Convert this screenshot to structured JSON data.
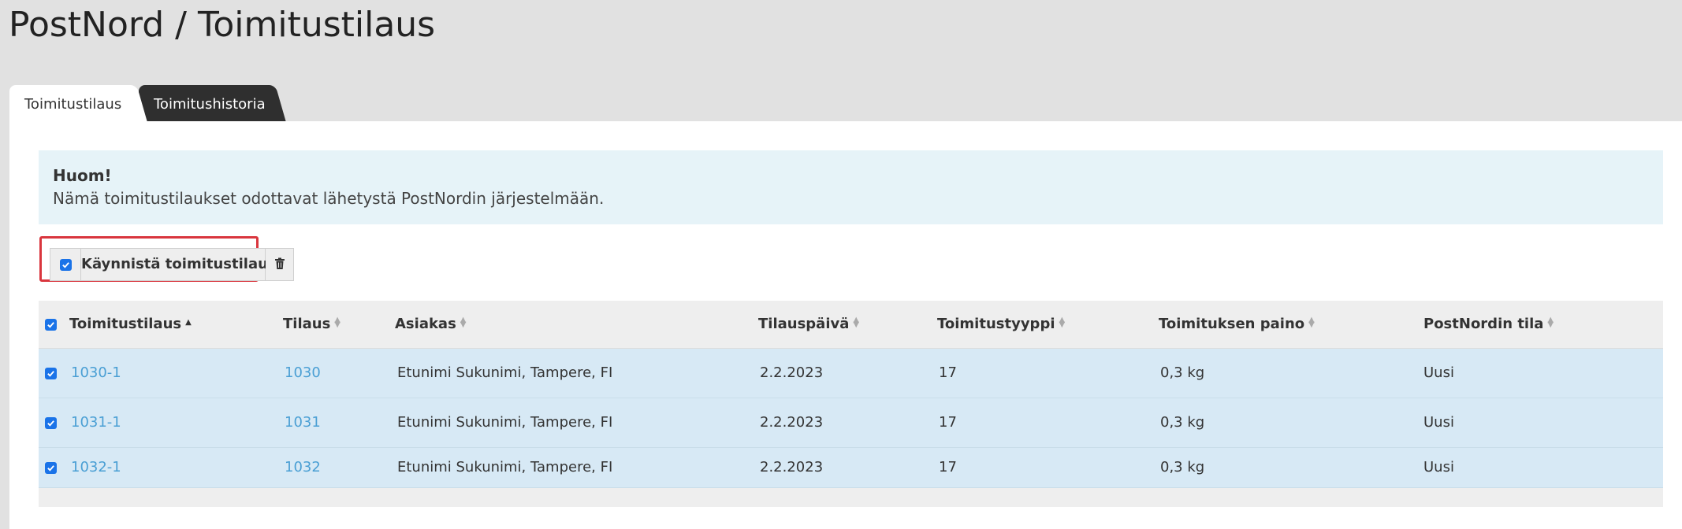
{
  "page": {
    "title": "PostNord / Toimitustilaus"
  },
  "tabs": [
    {
      "label": "Toimitustilaus",
      "active": true
    },
    {
      "label": "Toimitushistoria",
      "active": false
    }
  ],
  "notice": {
    "title": "Huom!",
    "text": "Nämä toimitustilaukset odottavat lähetystä PostNordin järjestelmään."
  },
  "toolbar": {
    "select_all_checked": true,
    "start_label": "Käynnistä toimitustilaus",
    "delete_icon": "trash-icon"
  },
  "table": {
    "columns": [
      {
        "label": "Toimitustilaus",
        "sort": "asc"
      },
      {
        "label": "Tilaus",
        "sort": "none"
      },
      {
        "label": "Asiakas",
        "sort": "none"
      },
      {
        "label": "Tilauspäivä",
        "sort": "none"
      },
      {
        "label": "Toimitustyyppi",
        "sort": "none"
      },
      {
        "label": "Toimituksen paino",
        "sort": "none"
      },
      {
        "label": "PostNordin tila",
        "sort": "none"
      }
    ],
    "rows": [
      {
        "checked": true,
        "delivery_order": "1030-1",
        "order": "1030",
        "customer": "Etunimi Sukunimi, Tampere, FI",
        "order_date": "2.2.2023",
        "delivery_type": "17",
        "weight": "0,3 kg",
        "status": "Uusi"
      },
      {
        "checked": true,
        "delivery_order": "1031-1",
        "order": "1031",
        "customer": "Etunimi Sukunimi, Tampere, FI",
        "order_date": "2.2.2023",
        "delivery_type": "17",
        "weight": "0,3 kg",
        "status": "Uusi"
      },
      {
        "checked": true,
        "delivery_order": "1032-1",
        "order": "1032",
        "customer": "Etunimi Sukunimi, Tampere, FI",
        "order_date": "2.2.2023",
        "delivery_type": "17",
        "weight": "0,3 kg",
        "status": "Uusi"
      }
    ]
  },
  "colors": {
    "accent_link": "#4a9fd4",
    "highlight_border": "#d9363e",
    "row_selected": "#d7e9f5",
    "notice_bg": "#e6f3f8"
  }
}
